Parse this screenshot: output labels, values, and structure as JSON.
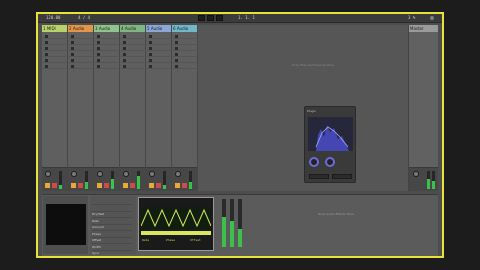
{
  "app": {
    "transport_tempo": "120.00",
    "transport_sig": "4 / 4",
    "position": "1. 1. 1",
    "cpu": "3 %"
  },
  "tracks": [
    {
      "name": "1 MIDI",
      "color": "#b8d16b"
    },
    {
      "name": "2 Audio",
      "color": "#e39548"
    },
    {
      "name": "3 Audio",
      "color": "#8fc58c"
    },
    {
      "name": "4 Audio",
      "color": "#80b680"
    },
    {
      "name": "5 Audio",
      "color": "#8aa7d8"
    },
    {
      "name": "6 Audio",
      "color": "#6fb7c9"
    }
  ],
  "master": {
    "name": "Master"
  },
  "session": {
    "drop_hint": "Drop Files and Devices Here"
  },
  "plugin": {
    "title": "Plugin"
  },
  "devices": {
    "drop_hint": "Drop Audio Effects Here",
    "params": [
      "Dry/Wet",
      "Rate",
      "Amount",
      "Phase",
      "Offset",
      "Width",
      "Sync",
      "Hold"
    ],
    "osc_labels": [
      "Rate",
      "Phase",
      "Offset"
    ]
  },
  "colors": {
    "accent_frame": "#e8e33a",
    "meter_green": "#37c44a",
    "solo": "#e9a83a",
    "arm": "#cf4b4b",
    "osc_wave": "#d9e85a"
  }
}
